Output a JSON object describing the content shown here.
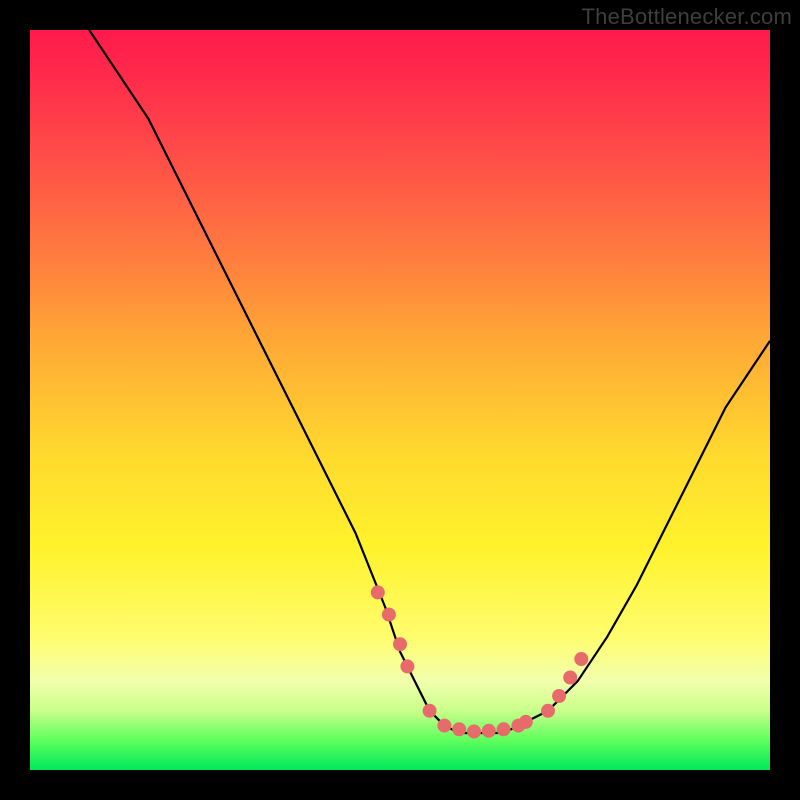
{
  "attribution": "TheBottlenecker.com",
  "chart_data": {
    "type": "line",
    "title": "",
    "xlabel": "",
    "ylabel": "",
    "xlim": [
      0,
      100
    ],
    "ylim": [
      0,
      100
    ],
    "series": [
      {
        "name": "bottleneck-curve",
        "x": [
          8,
          12,
          16,
          20,
          24,
          28,
          32,
          36,
          40,
          44,
          48,
          50,
          52,
          54,
          56,
          58,
          60,
          62,
          64,
          66,
          70,
          74,
          78,
          82,
          86,
          90,
          94,
          98,
          100
        ],
        "values": [
          100,
          94,
          88,
          80,
          72,
          64,
          56,
          48,
          40,
          32,
          22,
          16,
          12,
          8,
          6,
          5,
          5,
          5,
          5,
          6,
          8,
          12,
          18,
          25,
          33,
          41,
          49,
          55,
          58
        ]
      }
    ],
    "markers": {
      "name": "highlight-points",
      "x": [
        47,
        48.5,
        50,
        51,
        54,
        56,
        58,
        60,
        62,
        64,
        66,
        67,
        70,
        71.5,
        73,
        74.5
      ],
      "values": [
        24,
        21,
        17,
        14,
        8,
        6,
        5.5,
        5.2,
        5.3,
        5.5,
        6,
        6.5,
        8,
        10,
        12.5,
        15
      ]
    }
  }
}
